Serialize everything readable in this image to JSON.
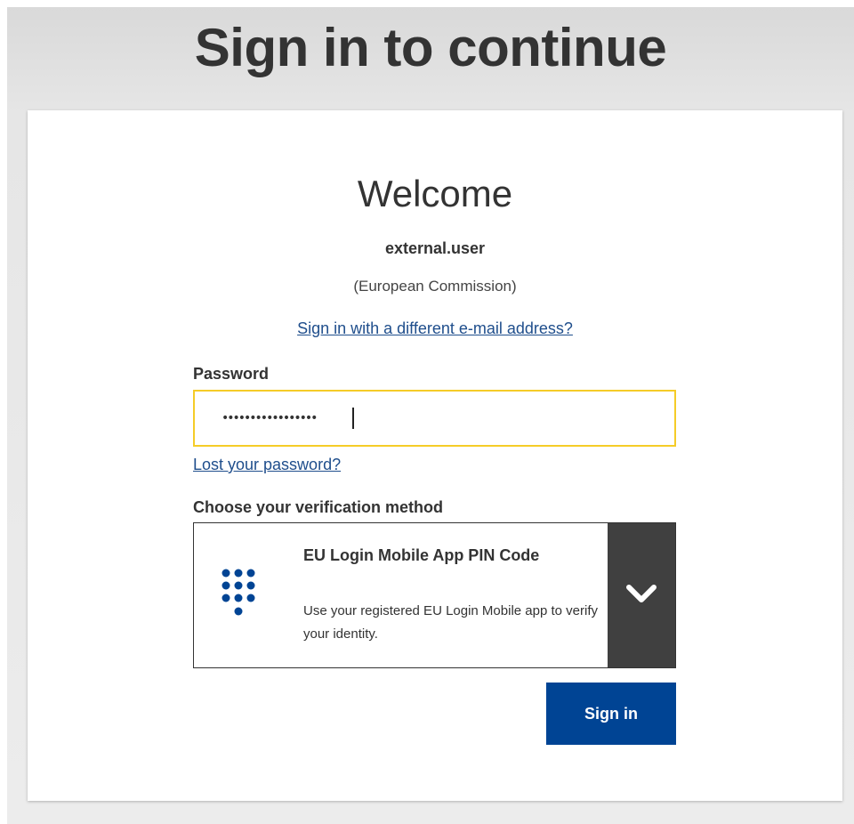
{
  "page": {
    "title": "Sign in to continue"
  },
  "card": {
    "welcome": "Welcome",
    "username": "external.user",
    "organisation": "(European Commission)",
    "different_email_link": "Sign in with a different e-mail address?",
    "password_label": "Password",
    "password_value": "•••••••••••••••••",
    "lost_password_link": "Lost your password?",
    "verification_label": "Choose your verification method",
    "verification": {
      "selected_title": "EU Login Mobile App PIN Code",
      "selected_description": "Use your registered EU Login Mobile app to verify your identity.",
      "icon": "keypad-icon"
    },
    "sign_in_button": "Sign in"
  },
  "colors": {
    "focus_border": "#f5cc28",
    "primary_button": "#004494",
    "link": "#1f4e8c",
    "dropdown_button": "#404040",
    "icon_blue": "#004494"
  }
}
